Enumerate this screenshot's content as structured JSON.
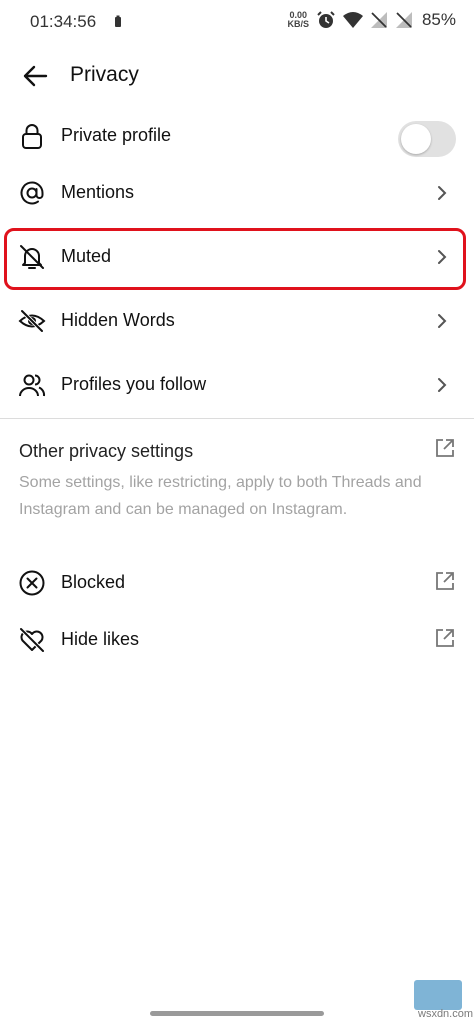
{
  "status_bar": {
    "time": "01:34:56",
    "net_speed_value": "0.00",
    "net_speed_unit": "KB/S",
    "battery_pct": "85%"
  },
  "header": {
    "title": "Privacy"
  },
  "menu": {
    "items": [
      {
        "label": "Private profile",
        "icon": "lock-icon",
        "control": "toggle",
        "toggle_on": false
      },
      {
        "label": "Mentions",
        "icon": "at-sign-icon",
        "control": "chevron"
      },
      {
        "label": "Muted",
        "icon": "bell-off-icon",
        "control": "chevron",
        "highlighted": true
      },
      {
        "label": "Hidden Words",
        "icon": "eye-off-icon",
        "control": "chevron"
      },
      {
        "label": "Profiles you follow",
        "icon": "people-icon",
        "control": "chevron"
      }
    ]
  },
  "other_settings": {
    "title": "Other privacy settings",
    "description": "Some settings, like restricting, apply to both Threads and Instagram and can be managed on Instagram.",
    "items": [
      {
        "label": "Blocked",
        "icon": "blocked-icon"
      },
      {
        "label": "Hide likes",
        "icon": "heart-off-icon"
      }
    ]
  },
  "watermark": {
    "text": "wsxdn.com"
  },
  "colors": {
    "highlight_border": "#e0121c",
    "secondary_text": "#a3a3a3",
    "toggle_off": "#e1e1e1"
  }
}
